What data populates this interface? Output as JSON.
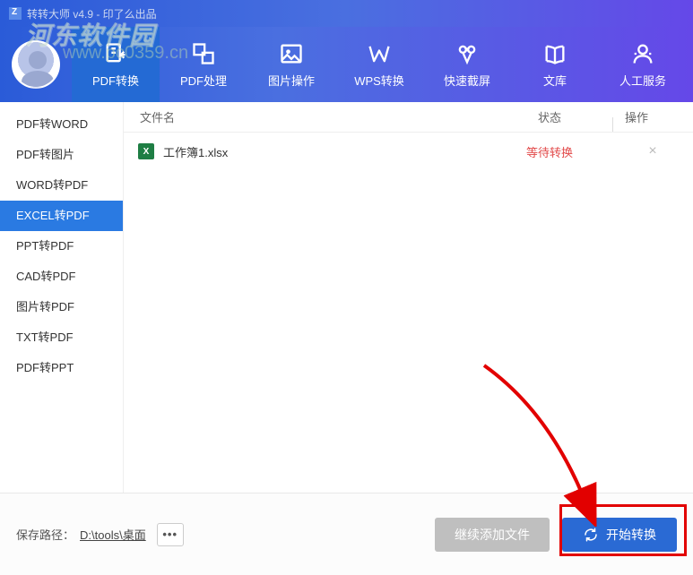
{
  "titlebar": {
    "text": "转转大师 v4.9 - 印了么出品"
  },
  "topnav": [
    {
      "label": "PDF转换",
      "icon": "pdf-convert",
      "active": true
    },
    {
      "label": "PDF处理",
      "icon": "pdf-process"
    },
    {
      "label": "图片操作",
      "icon": "image-op"
    },
    {
      "label": "WPS转换",
      "icon": "wps"
    },
    {
      "label": "快速截屏",
      "icon": "screenshot"
    },
    {
      "label": "文库",
      "icon": "library"
    },
    {
      "label": "人工服务",
      "icon": "service"
    }
  ],
  "sidebar": [
    {
      "label": "PDF转WORD"
    },
    {
      "label": "PDF转图片"
    },
    {
      "label": "WORD转PDF"
    },
    {
      "label": "EXCEL转PDF",
      "active": true
    },
    {
      "label": "PPT转PDF"
    },
    {
      "label": "CAD转PDF"
    },
    {
      "label": "图片转PDF"
    },
    {
      "label": "TXT转PDF"
    },
    {
      "label": "PDF转PPT"
    }
  ],
  "columns": {
    "name": "文件名",
    "status": "状态",
    "op": "操作"
  },
  "files": [
    {
      "icon": "X",
      "name": "工作簿1.xlsx",
      "status": "等待转换",
      "op": "×"
    }
  ],
  "footer": {
    "path_label": "保存路径：",
    "path_value": "D:\\tools\\桌面",
    "browse": "•••",
    "btn_add": "继续添加文件",
    "btn_start": "开始转换"
  }
}
